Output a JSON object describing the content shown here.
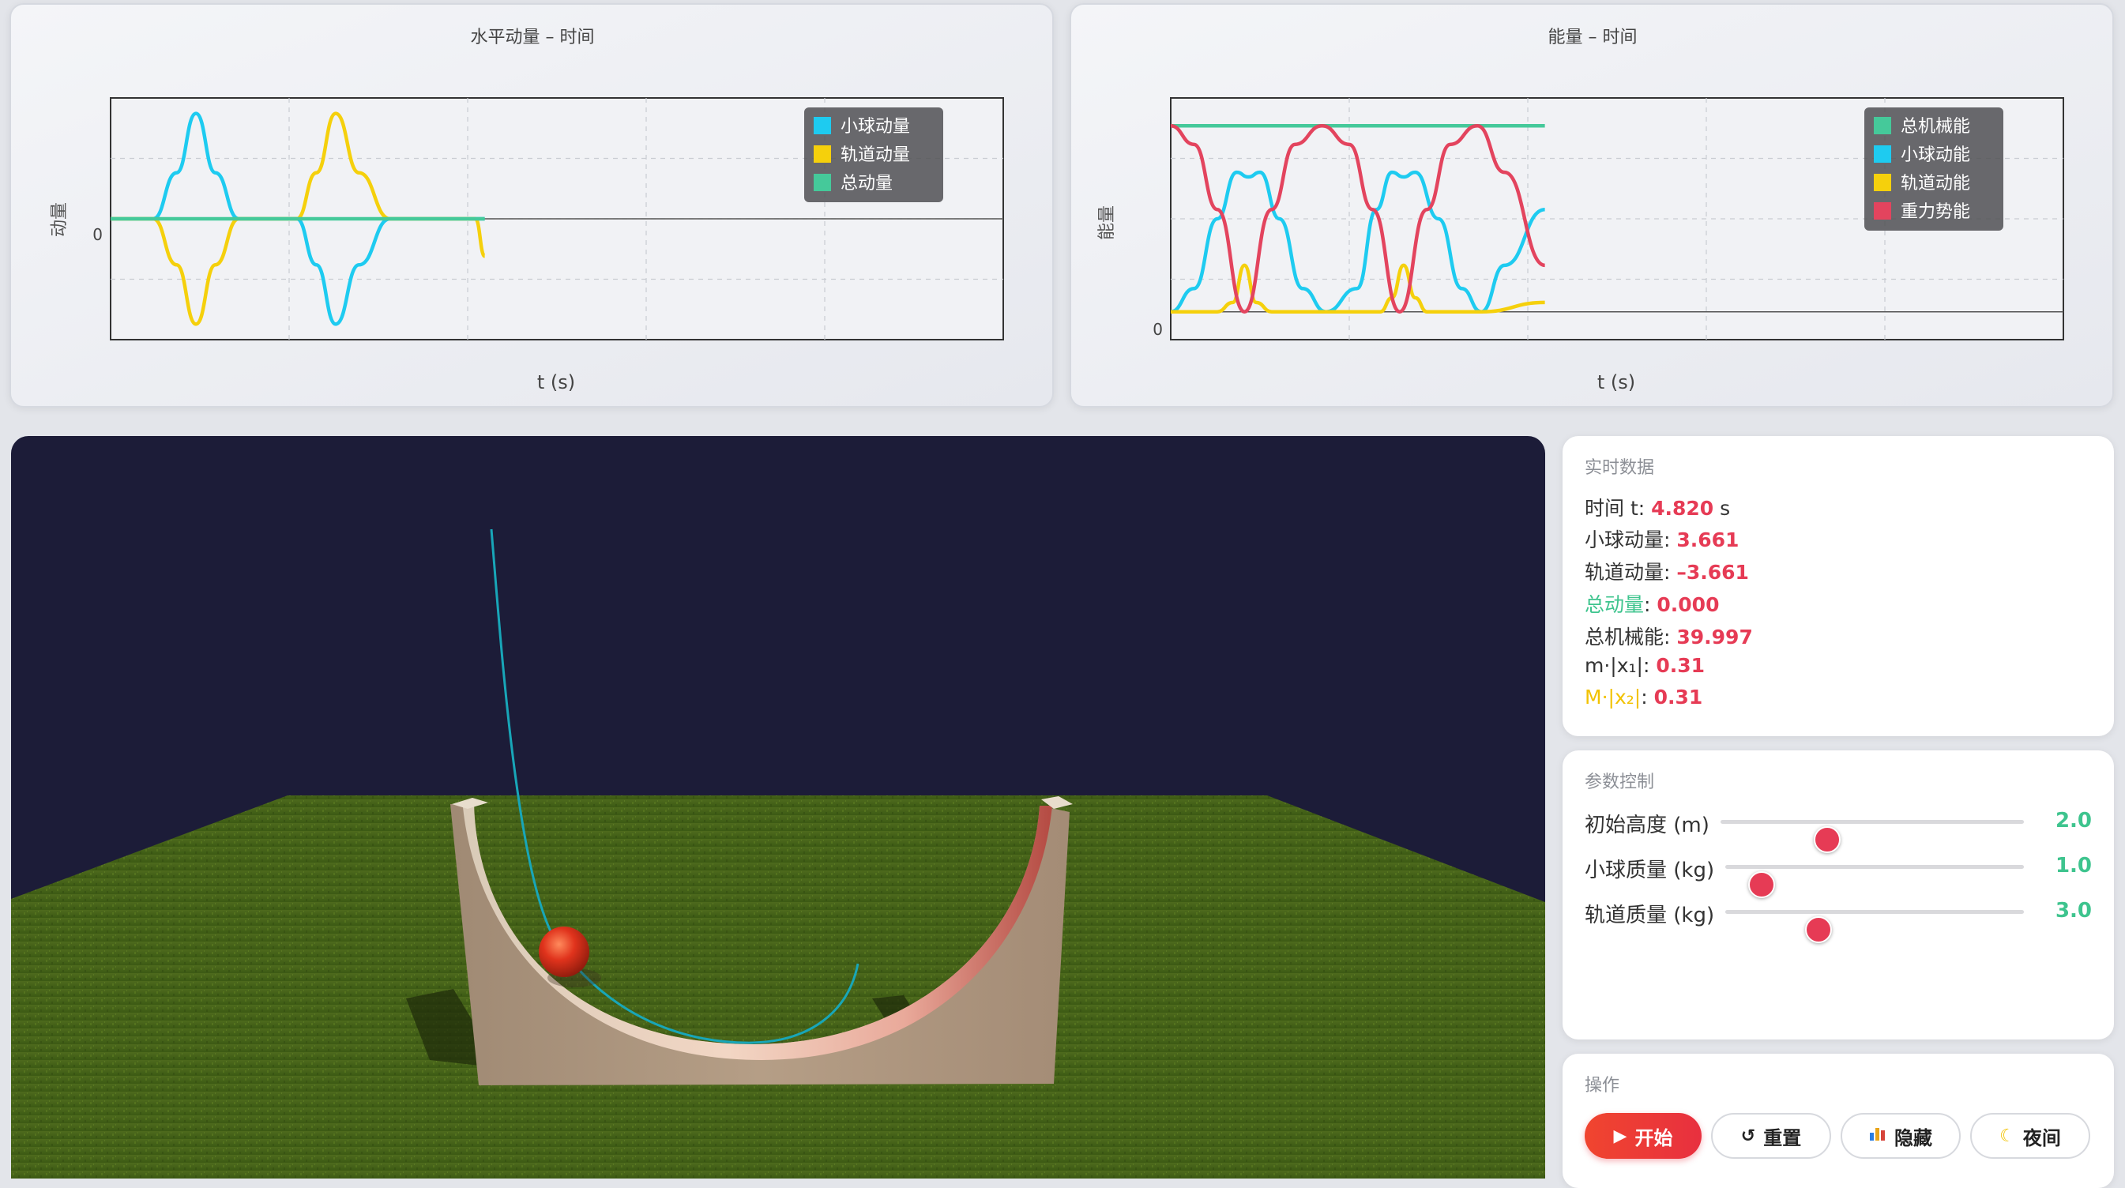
{
  "momentum_chart": {
    "title": "水平动量 – 时间",
    "ylabel": "动量",
    "xlabel": "t (s)",
    "zero_tick": "0",
    "legend": [
      {
        "label": "小球动量",
        "color": "#1ecbf0"
      },
      {
        "label": "轨道动量",
        "color": "#f5d00c"
      },
      {
        "label": "总动量",
        "color": "#45c99a"
      }
    ]
  },
  "energy_chart": {
    "title": "能量 – 时间",
    "ylabel": "能量",
    "xlabel": "t (s)",
    "zero_tick": "0",
    "legend": [
      {
        "label": "总机械能",
        "color": "#45c99a"
      },
      {
        "label": "小球动能",
        "color": "#1ecbf0"
      },
      {
        "label": "轨道动能",
        "color": "#f5d00c"
      },
      {
        "label": "重力势能",
        "color": "#e3445e"
      }
    ]
  },
  "chart_data": [
    {
      "type": "line",
      "title": "水平动量 – 时间",
      "xlabel": "t (s)",
      "ylabel": "动量",
      "legend_position": "top-right",
      "grid": true,
      "series": [
        {
          "name": "小球动量",
          "color": "#1ecbf0",
          "x": [
            0,
            0.55,
            0.85,
            1.1,
            1.35,
            1.65,
            2.2,
            2.4,
            2.65,
            2.9,
            3.2,
            3.6,
            4.0,
            4.82
          ],
          "values": [
            0,
            0,
            1.6,
            3.66,
            1.6,
            0,
            0,
            0,
            -1.6,
            -3.66,
            -1.6,
            0,
            0,
            0
          ]
        },
        {
          "name": "轨道动量",
          "color": "#f5d00c",
          "x": [
            0,
            0.55,
            0.85,
            1.1,
            1.35,
            1.65,
            2.2,
            2.4,
            2.65,
            2.9,
            3.2,
            3.6,
            4.0,
            4.7,
            4.82
          ],
          "values": [
            0,
            0,
            -1.6,
            -3.66,
            -1.6,
            0,
            0,
            0,
            1.6,
            3.66,
            1.6,
            0,
            0,
            0,
            -1.3
          ]
        },
        {
          "name": "总动量",
          "color": "#45c99a",
          "x": [
            0,
            4.82
          ],
          "values": [
            0,
            0
          ]
        }
      ]
    },
    {
      "type": "line",
      "title": "能量 – 时间",
      "xlabel": "t (s)",
      "ylabel": "能量",
      "legend_position": "top-right",
      "grid": true,
      "series": [
        {
          "name": "总机械能",
          "color": "#45c99a",
          "x": [
            0,
            4.82
          ],
          "values": [
            40,
            40
          ]
        },
        {
          "name": "小球动能",
          "color": "#1ecbf0",
          "x": [
            0,
            0.3,
            0.6,
            0.85,
            1.0,
            1.15,
            1.4,
            1.7,
            2.0,
            2.4,
            2.65,
            2.85,
            3.0,
            3.15,
            3.45,
            3.75,
            4.0,
            4.3,
            4.82
          ],
          "values": [
            0,
            5,
            20,
            30,
            29,
            30,
            20,
            5,
            0,
            5,
            22,
            30,
            29,
            30,
            20,
            5,
            0,
            10,
            22
          ]
        },
        {
          "name": "轨道动能",
          "color": "#f5d00c",
          "x": [
            0,
            0.6,
            0.8,
            0.95,
            1.1,
            1.3,
            2.0,
            2.7,
            2.85,
            3.0,
            3.15,
            3.3,
            4.0,
            4.82
          ],
          "values": [
            0,
            0,
            2,
            10,
            2,
            0,
            0,
            0,
            3,
            10,
            3,
            0,
            0,
            2
          ]
        },
        {
          "name": "重力势能",
          "color": "#e3445e",
          "x": [
            0,
            0.3,
            0.6,
            0.95,
            1.3,
            1.6,
            1.95,
            2.3,
            2.6,
            2.95,
            3.3,
            3.6,
            3.95,
            4.3,
            4.82
          ],
          "values": [
            40,
            36,
            22,
            0,
            22,
            36,
            40,
            36,
            22,
            0,
            22,
            36,
            40,
            30,
            10
          ]
        }
      ]
    }
  ],
  "realtime": {
    "title": "实时数据",
    "time_label": "时间 t: ",
    "time_value": "4.820",
    "time_unit": " s",
    "ball_momentum_label": "小球动量: ",
    "ball_momentum_value": "3.661",
    "track_momentum_label": "轨道动量: ",
    "track_momentum_value": "–3.661",
    "total_momentum_label": "总动量",
    "total_momentum_colon": ": ",
    "total_momentum_value": "0.000",
    "total_energy_label": "总机械能: ",
    "total_energy_value": "39.997",
    "m_x1_label": "m·|x₁|",
    "m_x1_colon": ": ",
    "m_x1_value": "0.31",
    "M_x2_label": "M·|x₂|",
    "M_x2_colon": ": ",
    "M_x2_value": "0.31"
  },
  "params": {
    "title": "参数控制",
    "height": {
      "label": "初始高度 (m)",
      "value": "2.0",
      "fraction": 0.35
    },
    "ball_mass": {
      "label": "小球质量 (kg)",
      "value": "1.0",
      "fraction": 0.12
    },
    "track_mass": {
      "label": "轨道质量 (kg)",
      "value": "3.0",
      "fraction": 0.31
    }
  },
  "actions": {
    "title": "操作",
    "start": "开始",
    "reset": "重置",
    "hide": "隐藏",
    "night": "夜间",
    "start_icon": "play-icon",
    "reset_icon": "refresh-icon",
    "hide_icon": "bar-chart-icon",
    "night_icon": "moon-icon"
  },
  "colors": {
    "accent": "#e63b55",
    "green": "#3ec48e",
    "yellow": "#f2c200",
    "scene_bg": "#1c1c38"
  }
}
